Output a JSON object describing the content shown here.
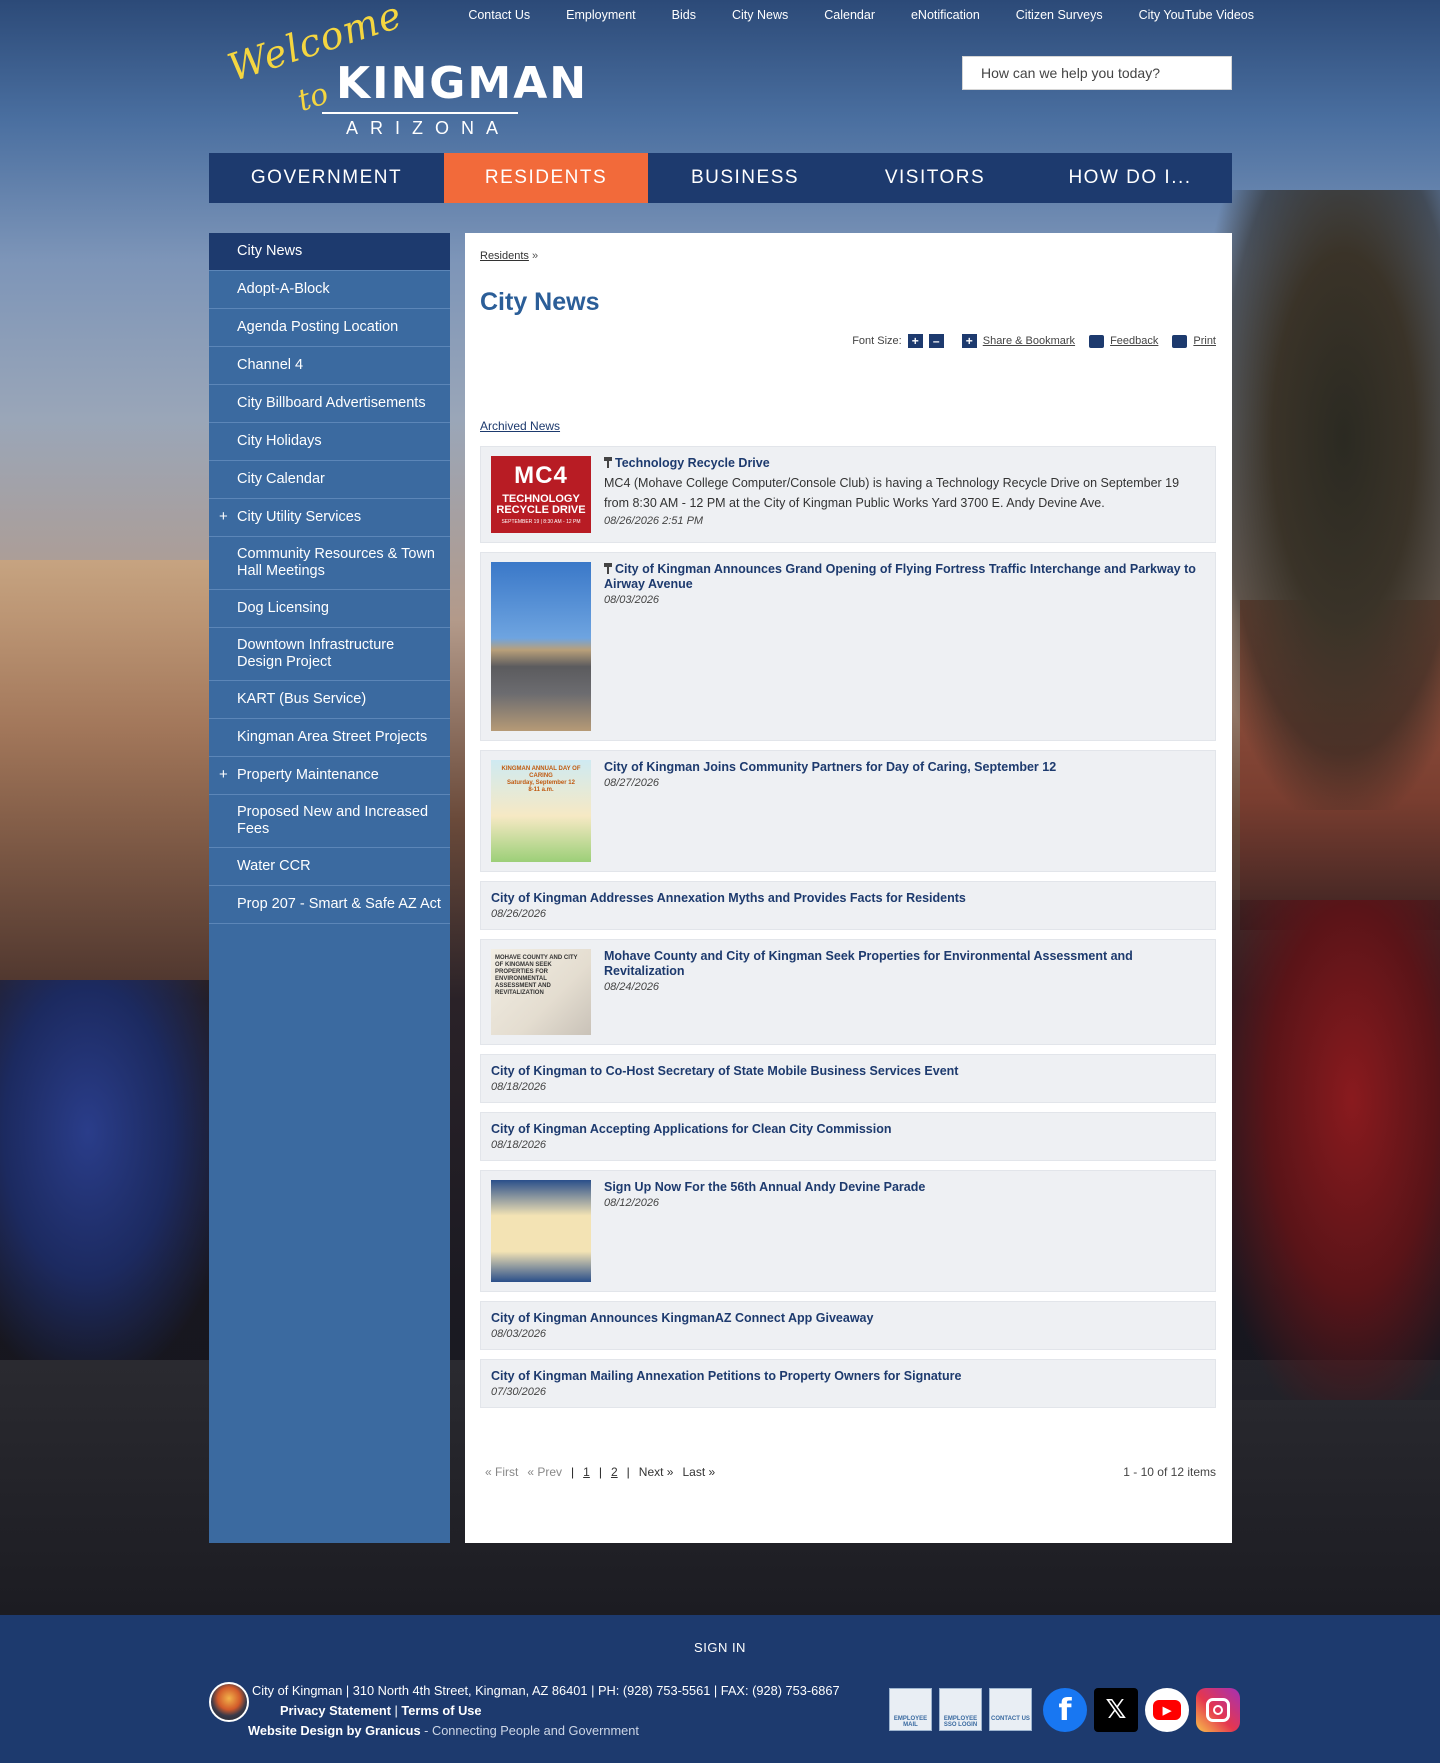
{
  "utility_nav": [
    "Contact Us",
    "Employment",
    "Bids",
    "City News",
    "Calendar",
    "eNotification",
    "Citizen Surveys",
    "City YouTube Videos"
  ],
  "logo": {
    "welcome": "Welcome",
    "to": "to",
    "city": "KINGMAN",
    "state": "ARIZONA"
  },
  "search": {
    "placeholder": "How can we help you today?"
  },
  "main_nav": [
    {
      "label": "GOVERNMENT",
      "active": false
    },
    {
      "label": "RESIDENTS",
      "active": true
    },
    {
      "label": "BUSINESS",
      "active": false
    },
    {
      "label": "VISITORS",
      "active": false
    },
    {
      "label": "HOW DO I...",
      "active": false
    }
  ],
  "sidebar": [
    {
      "label": "City News",
      "active": true,
      "expandable": false
    },
    {
      "label": "Adopt-A-Block",
      "expandable": false
    },
    {
      "label": "Agenda Posting Location",
      "expandable": false
    },
    {
      "label": "Channel 4",
      "expandable": false
    },
    {
      "label": "City Billboard Advertisements",
      "expandable": false
    },
    {
      "label": "City Holidays",
      "expandable": false
    },
    {
      "label": "City Calendar",
      "expandable": false
    },
    {
      "label": "City Utility Services",
      "expandable": true
    },
    {
      "label": "Community Resources & Town Hall Meetings",
      "expandable": false
    },
    {
      "label": "Dog Licensing",
      "expandable": false
    },
    {
      "label": "Downtown Infrastructure Design Project",
      "expandable": false
    },
    {
      "label": "KART (Bus Service)",
      "expandable": false
    },
    {
      "label": "Kingman Area Street Projects",
      "expandable": false
    },
    {
      "label": "Property Maintenance",
      "expandable": true
    },
    {
      "label": "Proposed New and Increased Fees",
      "expandable": false
    },
    {
      "label": "Water CCR",
      "expandable": false
    },
    {
      "label": "Prop 207 - Smart & Safe AZ Act",
      "expandable": false
    }
  ],
  "breadcrumb": {
    "link": "Residents",
    "sep": "»"
  },
  "page_title": "City News",
  "tools": {
    "font_size": "Font Size:",
    "plus": "+",
    "minus": "–",
    "share": "Share & Bookmark",
    "feedback": "Feedback",
    "print": "Print"
  },
  "archived_link": "Archived News",
  "news": [
    {
      "title": "Technology Recycle Drive",
      "pinned": true,
      "thumb": "mc4",
      "thumb_text": [
        "MC4",
        "TECHNOLOGY RECYCLE DRIVE",
        "SEPTEMBER 19 | 8:30 AM - 12 PM"
      ],
      "desc": "MC4 (Mohave College Computer/Console Club) is having a Technology Recycle Drive on September 19 from 8:30 AM - 12 PM at the City of Kingman Public Works Yard 3700 E. Andy Devine Ave.",
      "date": "08/26/2026 2:51 PM"
    },
    {
      "title": "City of Kingman Announces Grand Opening of Flying Fortress Traffic Interchange and Parkway to Airway Avenue",
      "pinned": true,
      "thumb": "road",
      "desc": "",
      "date": "08/03/2026"
    },
    {
      "title": "City of Kingman Joins Community Partners for Day of Caring, September 12",
      "pinned": false,
      "thumb": "caring",
      "thumb_text": [
        "KINGMAN ANNUAL DAY OF CARING",
        "Saturday, September 12",
        "8-11 a.m."
      ],
      "desc": "",
      "date": "08/27/2026"
    },
    {
      "title": "City of Kingman Addresses Annexation Myths and Provides Facts for Residents",
      "pinned": false,
      "thumb": "",
      "desc": "",
      "date": "08/26/2026"
    },
    {
      "title": "Mohave County and City of Kingman Seek Properties for Environmental Assessment and Revitalization",
      "pinned": false,
      "thumb": "mohave",
      "thumb_text": [
        "MOHAVE COUNTY AND CITY OF KINGMAN SEEK PROPERTIES FOR ENVIRONMENTAL ASSESSMENT AND REVITALIZATION"
      ],
      "desc": "",
      "date": "08/24/2026"
    },
    {
      "title": "City of Kingman to Co-Host Secretary of State Mobile Business Services Event",
      "pinned": false,
      "thumb": "",
      "desc": "",
      "date": "08/18/2026"
    },
    {
      "title": "City of Kingman Accepting Applications for Clean City Commission",
      "pinned": false,
      "thumb": "",
      "desc": "",
      "date": "08/18/2026"
    },
    {
      "title": "Sign Up Now For the 56th Annual Andy Devine Parade",
      "pinned": false,
      "thumb": "parade",
      "desc": "",
      "date": "08/12/2026"
    },
    {
      "title": "City of Kingman Announces KingmanAZ Connect App Giveaway",
      "pinned": false,
      "thumb": "",
      "desc": "",
      "date": "08/03/2026"
    },
    {
      "title": "City of Kingman Mailing Annexation Petitions to Property Owners for Signature",
      "pinned": false,
      "thumb": "",
      "desc": "",
      "date": "07/30/2026"
    }
  ],
  "pager": {
    "first": "« First",
    "prev": "« Prev",
    "sep": "|",
    "pages": [
      "1",
      "2"
    ],
    "next": "Next »",
    "last": "Last »",
    "count": "1 - 10 of 12 items"
  },
  "footer": {
    "signin": "SIGN IN",
    "address": "City of Kingman | 310 North 4th Street, Kingman, AZ 86401 | PH: (928) 753-5561 | FAX: (928) 753-6867",
    "privacy": "Privacy Statement",
    "terms": "Terms of Use",
    "link_sep": "|",
    "credit_link": "Website Design by Granicus",
    "credit_text": " - Connecting People and Government",
    "buttons": [
      "EMPLOYEE MAIL",
      "EMPLOYEE SSO LOGIN",
      "CONTACT US"
    ],
    "social": [
      "facebook-icon",
      "x-icon",
      "youtube-icon",
      "instagram-icon"
    ]
  }
}
